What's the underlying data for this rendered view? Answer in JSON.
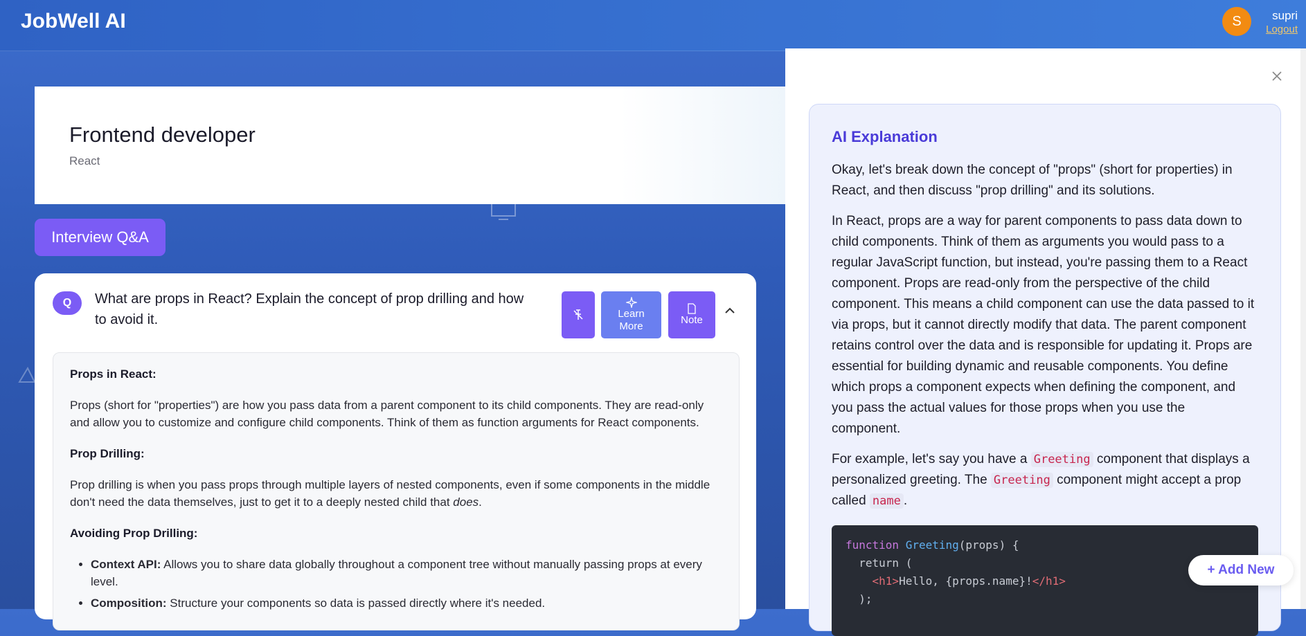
{
  "app": {
    "brand": "JobWell AI",
    "user": {
      "avatar_letter": "S",
      "name": "supri",
      "logout_label": "Logout"
    }
  },
  "hero": {
    "title": "Frontend developer",
    "subtitle": "React"
  },
  "tab": {
    "label": "Interview Q&A"
  },
  "question": {
    "badge": "Q",
    "text": "What are props in React? Explain the concept of prop drilling and how to avoid it.",
    "buttons": {
      "learn_line1": "Learn",
      "learn_line2": "More",
      "note": "Note"
    }
  },
  "answer": {
    "h1": "Props in React:",
    "p1": "Props (short for \"properties\") are how you pass data from a parent component to its child components. They are read-only and allow you to customize and configure child components. Think of them as function arguments for React components.",
    "h2": "Prop Drilling:",
    "p2_a": "Prop drilling is when you pass props through multiple layers of nested components, even if some components in the middle don't need the data themselves, just to get it to a deeply nested child that ",
    "p2_em": "does",
    "p2_b": ".",
    "h3": "Avoiding Prop Drilling:",
    "items": [
      {
        "title": "Context API:",
        "text": " Allows you to share data globally throughout a component tree without manually passing props at every level."
      },
      {
        "title": "Composition:",
        "text": " Structure your components so data is passed directly where it's needed."
      }
    ]
  },
  "explanation": {
    "title": "AI Explanation",
    "p1": "Okay, let's break down the concept of \"props\" (short for properties) in React, and then discuss \"prop drilling\" and its solutions.",
    "p2": "In React, props are a way for parent components to pass data down to child components. Think of them as arguments you would pass to a regular JavaScript function, but instead, you're passing them to a React component. Props are read-only from the perspective of the child component. This means a child component can use the data passed to it via props, but it cannot directly modify that data. The parent component retains control over the data and is responsible for updating it. Props are essential for building dynamic and reusable components. You define which props a component expects when defining the component, and you pass the actual values for those props when you use the component.",
    "p3_a": "For example, let's say you have a ",
    "p3_code1": "Greeting",
    "p3_b": " component that displays a personalized greeting. The ",
    "p3_code2": "Greeting",
    "p3_c": " component might accept a prop called ",
    "p3_code3": "name",
    "p3_d": ".",
    "code": {
      "l1_kw": "function",
      "l1_fn": "Greeting",
      "l1_rest": "(props) {",
      "l2": "  return (",
      "l3_pre": "    ",
      "l3_open": "<h1>",
      "l3_mid": "Hello, {props.name}!",
      "l3_close": "</h1>",
      "l4": "  );"
    }
  },
  "fab": {
    "label": "+ Add New"
  },
  "icons": [
    "pin-off-icon",
    "sparkle-icon",
    "note-icon",
    "chevron-up-icon",
    "close-icon",
    "monitor-icon"
  ]
}
